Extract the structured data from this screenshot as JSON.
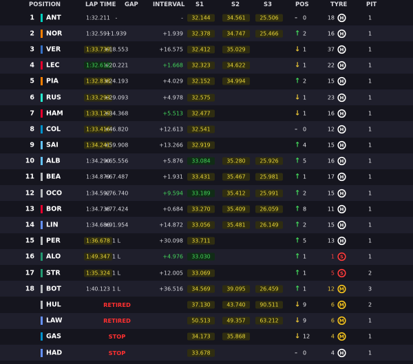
{
  "header": {
    "position": "POSITION",
    "lap_time": "LAP TIME",
    "gap": "GAP",
    "interval": "INTERVAL",
    "s1": "S1",
    "s2": "S2",
    "s3": "S3",
    "pos": "POS",
    "tyre": "TYRE",
    "pit": "PIT"
  },
  "colors": {
    "sector_yellow": "#e9d636",
    "sector_green": "#43d65a",
    "retired_red": "#ff3030",
    "row_alt": "#1f1f2c",
    "background": "#15151e"
  },
  "tyre_compounds": {
    "H": {
      "letter": "H",
      "color": "#ffffff",
      "name": "hard"
    },
    "S": {
      "letter": "S",
      "color": "#ff3b3b",
      "name": "soft"
    },
    "M": {
      "letter": "M",
      "color": "#f6c41d",
      "name": "medium"
    }
  },
  "drivers": [
    {
      "num": "1",
      "code": "ANT",
      "team_color": "#00d2be",
      "lap": "1:32.211",
      "lap_style": "plain",
      "gap": "-",
      "gap_style": "",
      "interval": "-",
      "interval_style": "",
      "s1": "32.144",
      "s1_style": "yellow",
      "s2": "34.561",
      "s2_style": "yellow",
      "s3": "25.506",
      "s3_style": "yellow",
      "pos_dir": "same",
      "pos_arrow": "-",
      "pos_val": "0",
      "laps": "18",
      "laps_style": "",
      "tyre": "H",
      "pit": "1"
    },
    {
      "num": "2",
      "code": "NOR",
      "team_color": "#ff8000",
      "lap": "1:32.591",
      "lap_style": "plain",
      "gap": "+1.939",
      "gap_style": "",
      "interval": "+1.939",
      "interval_style": "",
      "s1": "32.378",
      "s1_style": "yellow",
      "s2": "34.747",
      "s2_style": "yellow",
      "s3": "25.466",
      "s3_style": "yellow",
      "pos_dir": "up",
      "pos_arrow": "↑",
      "pos_val": "2",
      "laps": "16",
      "laps_style": "",
      "tyre": "H",
      "pit": "1"
    },
    {
      "num": "3",
      "code": "VER",
      "team_color": "#3671c6",
      "lap": "1:33.739",
      "lap_style": "yellow",
      "gap": "+18.553",
      "gap_style": "",
      "interval": "+16.575",
      "interval_style": "",
      "s1": "32.412",
      "s1_style": "yellow",
      "s2": "35.029",
      "s2_style": "yellow",
      "s3": "",
      "s3_style": "",
      "pos_dir": "down",
      "pos_arrow": "↓",
      "pos_val": "1",
      "laps": "37",
      "laps_style": "",
      "tyre": "H",
      "pit": "1"
    },
    {
      "num": "4",
      "code": "LEC",
      "team_color": "#e8002d",
      "lap": "1:32.612",
      "lap_style": "green",
      "gap": "+20.221",
      "gap_style": "",
      "interval": "+1.668",
      "interval_style": "green",
      "s1": "32.323",
      "s1_style": "yellow",
      "s2": "34.622",
      "s2_style": "yellow",
      "s3": "",
      "s3_style": "",
      "pos_dir": "down",
      "pos_arrow": "↓",
      "pos_val": "1",
      "laps": "22",
      "laps_style": "",
      "tyre": "H",
      "pit": "1"
    },
    {
      "num": "5",
      "code": "PIA",
      "team_color": "#ff8000",
      "lap": "1:32.838",
      "lap_style": "yellow",
      "gap": "+24.193",
      "gap_style": "",
      "interval": "+4.029",
      "interval_style": "",
      "s1": "32.152",
      "s1_style": "yellow",
      "s2": "34.994",
      "s2_style": "yellow",
      "s3": "",
      "s3_style": "",
      "pos_dir": "up",
      "pos_arrow": "↑",
      "pos_val": "2",
      "laps": "15",
      "laps_style": "",
      "tyre": "H",
      "pit": "1"
    },
    {
      "num": "6",
      "code": "RUS",
      "team_color": "#27f4d2",
      "lap": "1:33.293",
      "lap_style": "yellow",
      "gap": "+29.093",
      "gap_style": "",
      "interval": "+4.978",
      "interval_style": "",
      "s1": "32.575",
      "s1_style": "yellow",
      "s2": "",
      "s2_style": "",
      "s3": "",
      "s3_style": "",
      "pos_dir": "down",
      "pos_arrow": "↓",
      "pos_val": "1",
      "laps": "23",
      "laps_style": "",
      "tyre": "H",
      "pit": "1"
    },
    {
      "num": "7",
      "code": "HAM",
      "team_color": "#e8002d",
      "lap": "1:33.129",
      "lap_style": "yellow",
      "gap": "+34.368",
      "gap_style": "",
      "interval": "+5.513",
      "interval_style": "green",
      "s1": "32.477",
      "s1_style": "yellow",
      "s2": "",
      "s2_style": "",
      "s3": "",
      "s3_style": "",
      "pos_dir": "down",
      "pos_arrow": "↓",
      "pos_val": "1",
      "laps": "16",
      "laps_style": "",
      "tyre": "H",
      "pit": "1"
    },
    {
      "num": "8",
      "code": "COL",
      "team_color": "#0093cc",
      "lap": "1:33.416",
      "lap_style": "yellow",
      "gap": "+46.820",
      "gap_style": "",
      "interval": "+12.613",
      "interval_style": "",
      "s1": "32.541",
      "s1_style": "yellow",
      "s2": "",
      "s2_style": "",
      "s3": "",
      "s3_style": "",
      "pos_dir": "same",
      "pos_arrow": "-",
      "pos_val": "0",
      "laps": "12",
      "laps_style": "",
      "tyre": "H",
      "pit": "1"
    },
    {
      "num": "9",
      "code": "SAI",
      "team_color": "#64c4ff",
      "lap": "1:34.241",
      "lap_style": "yellow",
      "gap": "+59.908",
      "gap_style": "",
      "interval": "+13.266",
      "interval_style": "",
      "s1": "32.919",
      "s1_style": "yellow",
      "s2": "",
      "s2_style": "",
      "s3": "",
      "s3_style": "",
      "pos_dir": "up",
      "pos_arrow": "↑",
      "pos_val": "4",
      "laps": "15",
      "laps_style": "",
      "tyre": "H",
      "pit": "1"
    },
    {
      "num": "10",
      "code": "ALB",
      "team_color": "#64c4ff",
      "lap": "1:34.290",
      "lap_style": "plain",
      "gap": "+65.556",
      "gap_style": "",
      "interval": "+5.876",
      "interval_style": "",
      "s1": "33.084",
      "s1_style": "green",
      "s2": "35.280",
      "s2_style": "yellow",
      "s3": "25.926",
      "s3_style": "yellow",
      "pos_dir": "up",
      "pos_arrow": "↑",
      "pos_val": "5",
      "laps": "16",
      "laps_style": "",
      "tyre": "H",
      "pit": "1"
    },
    {
      "num": "11",
      "code": "BEA",
      "team_color": "#b6babd",
      "lap": "1:34.879",
      "lap_style": "plain",
      "gap": "+67.487",
      "gap_style": "",
      "interval": "+1.931",
      "interval_style": "",
      "s1": "33.431",
      "s1_style": "yellow",
      "s2": "35.467",
      "s2_style": "yellow",
      "s3": "25.981",
      "s3_style": "yellow",
      "pos_dir": "up",
      "pos_arrow": "↑",
      "pos_val": "1",
      "laps": "17",
      "laps_style": "",
      "tyre": "H",
      "pit": "1"
    },
    {
      "num": "12",
      "code": "OCO",
      "team_color": "#b6babd",
      "lap": "1:34.592",
      "lap_style": "plain",
      "gap": "+76.740",
      "gap_style": "",
      "interval": "+9.594",
      "interval_style": "green",
      "s1": "33.189",
      "s1_style": "green",
      "s2": "35.412",
      "s2_style": "yellow",
      "s3": "25.991",
      "s3_style": "yellow",
      "pos_dir": "up",
      "pos_arrow": "↑",
      "pos_val": "2",
      "laps": "15",
      "laps_style": "",
      "tyre": "H",
      "pit": "1"
    },
    {
      "num": "13",
      "code": "BOR",
      "team_color": "#e8002d",
      "lap": "1:34.738",
      "lap_style": "plain",
      "gap": "+77.424",
      "gap_style": "",
      "interval": "+0.684",
      "interval_style": "",
      "s1": "33.270",
      "s1_style": "yellow",
      "s2": "35.409",
      "s2_style": "yellow",
      "s3": "26.059",
      "s3_style": "yellow",
      "pos_dir": "up",
      "pos_arrow": "↑",
      "pos_val": "8",
      "laps": "11",
      "laps_style": "",
      "tyre": "H",
      "pit": "1"
    },
    {
      "num": "14",
      "code": "LIN",
      "team_color": "#6692ff",
      "lap": "1:34.686",
      "lap_style": "plain",
      "gap": "+91.954",
      "gap_style": "",
      "interval": "+14.872",
      "interval_style": "",
      "s1": "33.056",
      "s1_style": "yellow",
      "s2": "35.481",
      "s2_style": "yellow",
      "s3": "26.149",
      "s3_style": "yellow",
      "pos_dir": "up",
      "pos_arrow": "↑",
      "pos_val": "2",
      "laps": "15",
      "laps_style": "",
      "tyre": "H",
      "pit": "1"
    },
    {
      "num": "15",
      "code": "PER",
      "team_color": "#b6babd",
      "lap": "1:36.678",
      "lap_style": "yellow",
      "gap": "1 L",
      "gap_style": "",
      "interval": "+30.098",
      "interval_style": "",
      "s1": "33.711",
      "s1_style": "yellow",
      "s2": "",
      "s2_style": "",
      "s3": "",
      "s3_style": "",
      "pos_dir": "up",
      "pos_arrow": "↑",
      "pos_val": "5",
      "laps": "13",
      "laps_style": "",
      "tyre": "H",
      "pit": "1"
    },
    {
      "num": "16",
      "code": "ALO",
      "team_color": "#229971",
      "lap": "1:49.347",
      "lap_style": "yellow",
      "gap": "1 L",
      "gap_style": "",
      "interval": "+4.976",
      "interval_style": "green",
      "s1": "33.030",
      "s1_style": "green",
      "s2": "",
      "s2_style": "",
      "s3": "",
      "s3_style": "",
      "pos_dir": "up",
      "pos_arrow": "↑",
      "pos_val": "1",
      "laps": "1",
      "laps_style": "red",
      "tyre": "S",
      "pit": "1"
    },
    {
      "num": "17",
      "code": "STR",
      "team_color": "#229971",
      "lap": "1:35.324",
      "lap_style": "yellow",
      "gap": "1 L",
      "gap_style": "",
      "interval": "+12.005",
      "interval_style": "",
      "s1": "33.069",
      "s1_style": "yellow",
      "s2": "",
      "s2_style": "",
      "s3": "",
      "s3_style": "",
      "pos_dir": "up",
      "pos_arrow": "↑",
      "pos_val": "1",
      "laps": "5",
      "laps_style": "red",
      "tyre": "S",
      "pit": "2"
    },
    {
      "num": "18",
      "code": "BOT",
      "team_color": "#b6babd",
      "lap": "1:40.123",
      "lap_style": "plain",
      "gap": "1 L",
      "gap_style": "",
      "interval": "+36.516",
      "interval_style": "",
      "s1": "34.569",
      "s1_style": "yellow",
      "s2": "39.095",
      "s2_style": "yellow",
      "s3": "26.459",
      "s3_style": "yellow",
      "pos_dir": "up",
      "pos_arrow": "↑",
      "pos_val": "1",
      "laps": "12",
      "laps_style": "yellow",
      "tyre": "M",
      "pit": "3"
    },
    {
      "num": "",
      "code": "HUL",
      "team_color": "#b6babd",
      "lap": "",
      "lap_style": "",
      "gap": "RETIRED",
      "gap_style": "retired",
      "interval": "",
      "interval_style": "",
      "s1": "37.130",
      "s1_style": "yellow",
      "s2": "43.740",
      "s2_style": "yellow",
      "s3": "90.511",
      "s3_style": "yellow",
      "pos_dir": "down",
      "pos_arrow": "↓",
      "pos_val": "9",
      "laps": "6",
      "laps_style": "yellow",
      "tyre": "M",
      "pit": "2"
    },
    {
      "num": "",
      "code": "LAW",
      "team_color": "#6692ff",
      "lap": "",
      "lap_style": "",
      "gap": "RETIRED",
      "gap_style": "retired",
      "interval": "",
      "interval_style": "",
      "s1": "50.513",
      "s1_style": "yellow",
      "s2": "49.357",
      "s2_style": "yellow",
      "s3": "63.212",
      "s3_style": "yellow",
      "pos_dir": "down",
      "pos_arrow": "↓",
      "pos_val": "9",
      "laps": "6",
      "laps_style": "yellow",
      "tyre": "M",
      "pit": "1"
    },
    {
      "num": "",
      "code": "GAS",
      "team_color": "#0093cc",
      "lap": "",
      "lap_style": "",
      "gap": "STOP",
      "gap_style": "retired",
      "interval": "",
      "interval_style": "",
      "s1": "34.173",
      "s1_style": "yellow",
      "s2": "35.868",
      "s2_style": "yellow",
      "s3": "",
      "s3_style": "",
      "pos_dir": "down",
      "pos_arrow": "↓",
      "pos_val": "12",
      "laps": "4",
      "laps_style": "yellow",
      "tyre": "M",
      "pit": "1"
    },
    {
      "num": "",
      "code": "HAD",
      "team_color": "#6692ff",
      "lap": "",
      "lap_style": "",
      "gap": "STOP",
      "gap_style": "retired",
      "interval": "",
      "interval_style": "",
      "s1": "33.678",
      "s1_style": "yellow",
      "s2": "",
      "s2_style": "",
      "s3": "",
      "s3_style": "",
      "pos_dir": "same",
      "pos_arrow": "-",
      "pos_val": "0",
      "laps": "4",
      "laps_style": "",
      "tyre": "H",
      "pit": "1"
    }
  ]
}
